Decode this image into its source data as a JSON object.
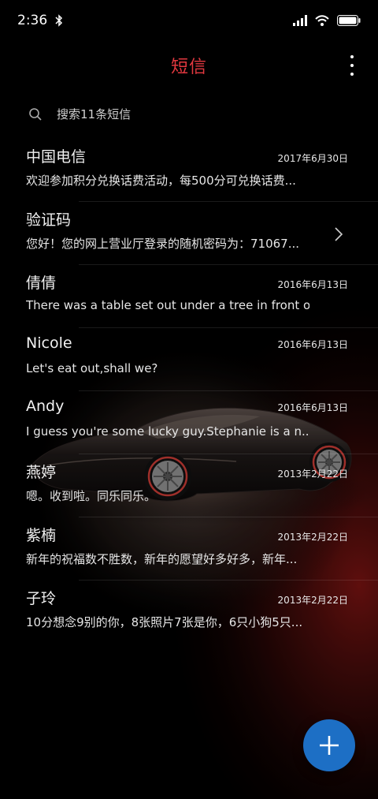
{
  "status_bar": {
    "time": "2:36",
    "icons": [
      "bluetooth-icon",
      "signal-icon",
      "wifi-icon",
      "battery-icon"
    ]
  },
  "header": {
    "title": "短信",
    "more_icon": "more-vertical-icon"
  },
  "search": {
    "placeholder": "搜索11条短信",
    "icon": "search-icon"
  },
  "messages": [
    {
      "sender": "中国电信",
      "date": "2017年6月30日",
      "preview": "欢迎参加积分兑换话费活动，每500分可兑换话费..."
    },
    {
      "sender": "验证码",
      "date": "",
      "preview": "您好！您的网上营业厅登录的随机密码为：71067...",
      "icon": "chevron-right-icon"
    },
    {
      "sender": "倩倩",
      "date": "2016年6月13日",
      "preview": "There was a table set out under a tree in front o..."
    },
    {
      "sender": "Nicole",
      "date": "2016年6月13日",
      "preview": "Let's eat out,shall we?"
    },
    {
      "sender": "Andy",
      "date": "2016年6月13日",
      "preview": "I guess you're some lucky guy.Stephanie is a n..."
    },
    {
      "sender": "燕婷",
      "date": "2013年2月22日",
      "preview": "嗯。收到啦。同乐同乐。"
    },
    {
      "sender": "紫楠",
      "date": "2013年2月22日",
      "preview": "新年的祝福数不胜数，新年的愿望好多好多，新年..."
    },
    {
      "sender": "子玲",
      "date": "2013年2月22日",
      "preview": "10分想念9别的你，8张照片7张是你，6只小狗5只..."
    }
  ],
  "fab": {
    "icon": "plus-icon"
  },
  "colors": {
    "accent": "#e2383f",
    "fab": "#1d6fc5",
    "background": "#000000"
  }
}
